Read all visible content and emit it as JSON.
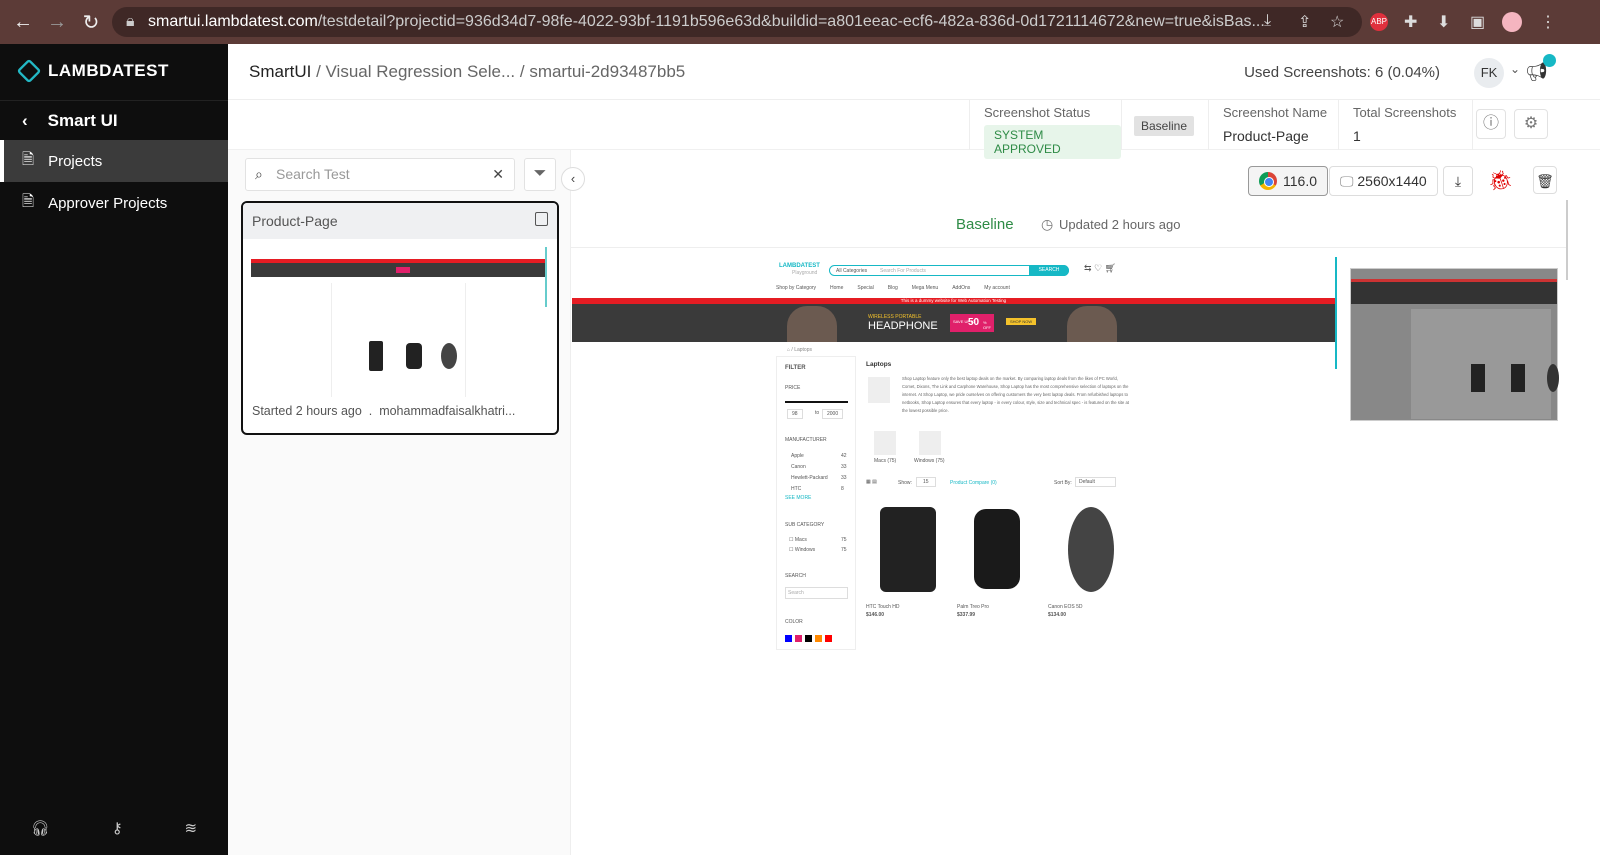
{
  "browser": {
    "url_host": "smartui.lambdatest.com",
    "url_path": "/testdetail?projectid=936d34d7-98fe-4022-93bf-1191b596e63d&buildid=a801eeac-ecf6-482a-836d-0d1721114672&new=true&isBas...",
    "abp": "ABP"
  },
  "sidebar": {
    "logo": "LAMBDATEST",
    "back_label": "Smart UI",
    "items": [
      {
        "label": "Projects"
      },
      {
        "label": "Approver Projects"
      }
    ]
  },
  "header": {
    "breadcrumb_root": "SmartUI",
    "breadcrumb_mid": " / Visual Regression Sele... / ",
    "breadcrumb_current": "smartui-2d93487bb5",
    "used": "Used Screenshots: 6 (0.04%)",
    "avatar": "FK"
  },
  "info": {
    "status_label": "Screenshot Status",
    "status_value": "SYSTEM APPROVED",
    "baseline_tag": "Baseline",
    "name_label": "Screenshot Name",
    "name_value": "Product-Page",
    "total_label": "Total Screenshots",
    "total_value": "1"
  },
  "left": {
    "search_placeholder": "Search Test",
    "card_title": "Product-Page",
    "card_started": "Started 2 hours ago",
    "card_sep": ".",
    "card_user": "mohammadfaisalkhatri..."
  },
  "toolbar": {
    "browser_version": "116.0",
    "resolution": "2560x1440"
  },
  "view": {
    "title": "Baseline",
    "updated": "Updated 2 hours ago"
  },
  "site": {
    "logo": "LAMBDATEST",
    "logo_sub": "Playground",
    "categories": "All Categories",
    "search_ph": "Search For Products",
    "search_btn": "SEARCH",
    "nav": [
      "Shop by Category",
      "Home",
      "Special",
      "Blog",
      "Mega Menu",
      "AddOns",
      "My account"
    ],
    "notice": "This is a dummy website for Web Automation Testing",
    "banner_small": "WIRELESS PORTABLE",
    "banner_big": "HEADPHONE",
    "banner_save": "SAVE UPTO",
    "banner_pct": "50",
    "banner_off": "% OFF",
    "banner_btn": "SHOP NOW",
    "crumb": "Laptops",
    "filter": "FILTER",
    "price": "PRICE",
    "price_min": "98",
    "price_to": "to",
    "price_max": "2000",
    "manufacturer": "MANUFACTURER",
    "makers": [
      {
        "n": "Apple",
        "c": "42"
      },
      {
        "n": "Canon",
        "c": "33"
      },
      {
        "n": "Hewlett-Packard",
        "c": "33"
      },
      {
        "n": "HTC",
        "c": "8"
      }
    ],
    "see_more": "SEE MORE",
    "subcat": "SUB CATEGORY",
    "subs": [
      {
        "n": "Macs",
        "c": "75"
      },
      {
        "n": "Windows",
        "c": "75"
      }
    ],
    "search_label": "SEARCH",
    "search_box": "Search",
    "color_label": "COLOR",
    "heading": "Laptops",
    "desc": "Shop Laptop feature only the best laptop deals on the market. By comparing laptop deals from the likes of PC World, Comet, Dixons, The Link and Carphone Warehouse, Shop Laptop has the most comprehensive selection of laptops on the internet. At Shop Laptop, we pride ourselves on offering customers the very best laptop deals. From refurbished laptops to netbooks, Shop Laptop ensures that every laptop - in every colour, style, size and technical spec - is featured on the site at the lowest possible price.",
    "cat1": "Macs (75)",
    "cat2": "Windows (75)",
    "show": "Show:",
    "show_val": "15",
    "compare": "Product Compare (0)",
    "sort": "Sort By:",
    "sort_val": "Default",
    "products": [
      {
        "name": "HTC Touch HD",
        "price": "$146.00"
      },
      {
        "name": "Palm Treo Pro",
        "price": "$337.99"
      },
      {
        "name": "Canon EOS 5D",
        "price": "$134.00"
      }
    ]
  },
  "colors": {
    "teal": "#16b8c5",
    "approved": "#2e8b46",
    "bug": "#e00000"
  }
}
